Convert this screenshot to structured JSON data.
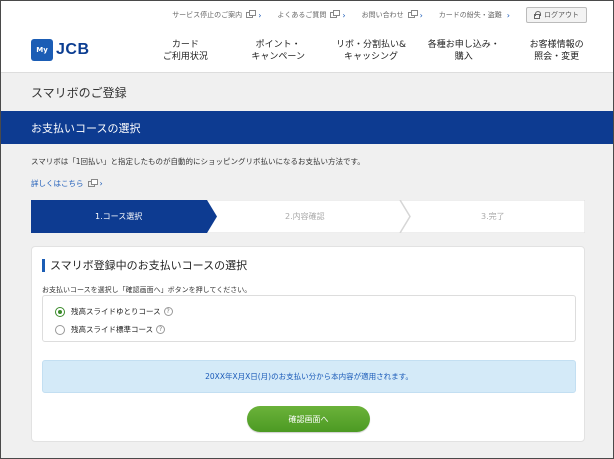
{
  "utility": {
    "links": [
      {
        "label": "サービス停止のご案内",
        "icon": "external-link-icon"
      },
      {
        "label": "よくあるご質問",
        "icon": "external-link-icon"
      },
      {
        "label": "お問い合わせ",
        "icon": "external-link-icon"
      },
      {
        "label": "カードの紛失・盗難",
        "icon": "chevron-right-icon"
      }
    ],
    "logout_label": "ログアウト"
  },
  "logo": {
    "my": "My",
    "brand": "JCB"
  },
  "nav": {
    "items": [
      {
        "label": "カード\nご利用状況"
      },
      {
        "label": "ポイント・\nキャンペーン"
      },
      {
        "label": "リボ・分割払い&\nキャッシング"
      },
      {
        "label": "各種お申し込み・\n購入"
      },
      {
        "label": "お客様情報の\n照会・変更"
      }
    ]
  },
  "page": {
    "title": "スマリボのご登録"
  },
  "section": {
    "title": "お支払いコースの選択",
    "description": "スマリボは「1回払い」と指定したものが自動的にショッピングリボ払いになるお支払い方法です。",
    "detail_link": "詳しくはこちら"
  },
  "steps": [
    {
      "label": "1.コース選択",
      "active": true
    },
    {
      "label": "2.内容確認",
      "active": false
    },
    {
      "label": "3.完了",
      "active": false
    }
  ],
  "card": {
    "heading": "スマリボ登録中のお支払いコースの選択",
    "instruction": "お支払いコースを選択し「確認画面へ」ボタンを押してください。",
    "options": [
      {
        "label": "残高スライドゆとりコース",
        "selected": true
      },
      {
        "label": "残高スライド標準コース",
        "selected": false
      }
    ],
    "help_glyph": "?",
    "notice": "20XX年X月X日(月)のお支払い分から本内容が適用されます。",
    "confirm_label": "確認画面へ"
  },
  "colors": {
    "brand_blue": "#0d3b91",
    "step_active": "#0d3b91",
    "button_green": "#4c9a23",
    "notice_bg": "#d4eaf8"
  }
}
